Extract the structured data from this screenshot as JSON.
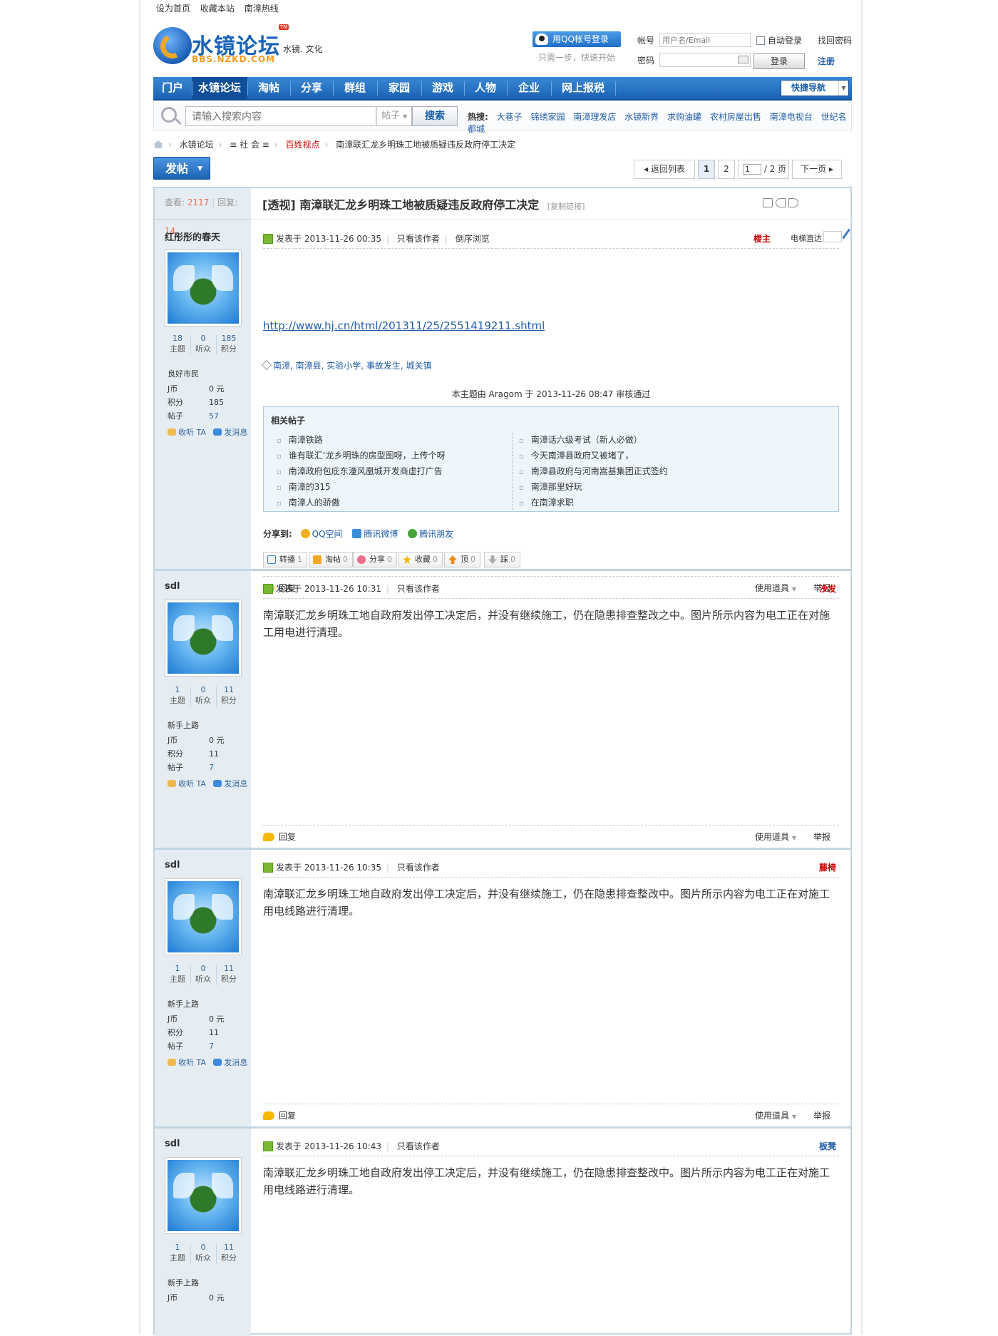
{
  "toplinks": [
    "设为首页",
    "收藏本站",
    "南漳热线"
  ],
  "logo": {
    "title": "水镜论坛",
    "sub": "BBS.NZKD.COM",
    "tm": "TM",
    "slogan": "水镜. 文化"
  },
  "login": {
    "qq_button": "用QQ帐号登录",
    "qq_hint": "只需一步，快速开始",
    "account_label": "帐号",
    "account_placeholder": "用户名/Email",
    "password_label": "密码",
    "auto_login": "自动登录",
    "login_button": "登录",
    "find_password": "找回密码",
    "register": "注册"
  },
  "nav": {
    "items": [
      "门户",
      "水镜论坛",
      "淘帖",
      "分享",
      "群组",
      "家园",
      "游戏",
      "人物",
      "企业",
      "网上报税"
    ],
    "active": "水镜论坛",
    "quick_nav": "快捷导航"
  },
  "search": {
    "placeholder": "请输入搜索内容",
    "type": "帖子",
    "button": "搜索",
    "hot_label": "热搜:",
    "hot": [
      "大巷子",
      "锦绣家园",
      "南漳理发店",
      "水镜新界",
      "求购油罐",
      "农村房屋出售",
      "南漳电视台",
      "世纪名都城"
    ]
  },
  "breadcrumb": [
    "水镜论坛",
    "≡ 社 会 ≡",
    "百姓视点",
    "南漳联汇龙乡明珠工地被质疑违反政府停工决定"
  ],
  "toolbar": {
    "post_button": "发帖",
    "back": "返回列表",
    "pages": [
      "1",
      "2"
    ],
    "page_input": "1",
    "page_total": "/ 2 页",
    "next": "下一页"
  },
  "thread": {
    "views_label": "查看:",
    "views": "2117",
    "replies_label": "回复:",
    "replies": "14",
    "title": "[透视] 南漳联汇龙乡明珠工地被质疑违反政府停工决定",
    "copy_link": "[复制链接]"
  },
  "posts": [
    {
      "author": "红彤彤的春天",
      "topics": "18",
      "topics_label": "主题",
      "fans": "0",
      "fans_label": "听众",
      "credits": "185",
      "credits_label": "积分",
      "rank": "良好市民",
      "coins_label": "J币",
      "coins": "0 元",
      "score_label": "积分",
      "score": "185",
      "posts_label": "帖子",
      "posts_count": "57",
      "follow": "收听 TA",
      "message": "发消息",
      "posted_label": "发表于",
      "time": "2013-11-26 00:35",
      "only_author": "只看该作者",
      "reverse": "倒序浏览",
      "floor": "楼主",
      "elevator": "电梯直达",
      "link": "http://www.hj.cn/html/201311/25/2551419211.shtml",
      "tags": "南漳, 南漳县, 实验小学, 事故发生, 城关镇",
      "review": "本主题由  Aragom 于  2013-11-26 08:47 审核通过"
    },
    {
      "author": "sdl",
      "topics": "1",
      "topics_label": "主题",
      "fans": "0",
      "fans_label": "听众",
      "credits": "11",
      "credits_label": "积分",
      "rank": "新手上路",
      "coins_label": "J币",
      "coins": "0 元",
      "score_label": "积分",
      "score": "11",
      "posts_label": "帖子",
      "posts_count": "7",
      "follow": "收听 TA",
      "message": "发消息",
      "posted_label": "发表于",
      "time": "2013-11-26 10:31",
      "only_author": "只看该作者",
      "floor": "沙发",
      "content": "南漳联汇龙乡明珠工地自政府发出停工决定后，并没有继续施工，仍在隐患排查整改之中。图片所示内容为电工正在对施工用电进行清理。"
    },
    {
      "author": "sdl",
      "topics": "1",
      "topics_label": "主题",
      "fans": "0",
      "fans_label": "听众",
      "credits": "11",
      "credits_label": "积分",
      "rank": "新手上路",
      "coins_label": "J币",
      "coins": "0 元",
      "score_label": "积分",
      "score": "11",
      "posts_label": "帖子",
      "posts_count": "7",
      "follow": "收听 TA",
      "message": "发消息",
      "posted_label": "发表于",
      "time": "2013-11-26 10:35",
      "only_author": "只看该作者",
      "floor": "藤椅",
      "content": "南漳联汇龙乡明珠工地自政府发出停工决定后，并没有继续施工，仍在隐患排查整改中。图片所示内容为电工正在对施工用电线路进行清理。"
    },
    {
      "author": "sdl",
      "topics": "1",
      "topics_label": "主题",
      "fans": "0",
      "fans_label": "听众",
      "credits": "11",
      "credits_label": "积分",
      "rank": "新手上路",
      "coins_label": "J币",
      "coins": "0 元",
      "posted_label": "发表于",
      "time": "2013-11-26 10:43",
      "only_author": "只看该作者",
      "floor": "板凳",
      "content": "南漳联汇龙乡明珠工地自政府发出停工决定后，并没有继续施工，仍在隐患排查整改中。图片所示内容为电工正在对施工用电线路进行清理。"
    }
  ],
  "related": {
    "title": "相关帖子",
    "left": [
      "南漳铁路",
      "谁有联汇‘龙乡明珠的房型图呀，上传个呀",
      "南漳政府包庇东潼风凰城开发商虚打广告",
      "南漳的315",
      "南漳人的骄傲"
    ],
    "right": [
      "南漳话六级考试（新人必做）",
      "今天南漳县政府又被堵了，",
      "南漳县政府与河南嵩基集团正式签约",
      "南漳那里好玩",
      "在南漳求职"
    ]
  },
  "share": {
    "label": "分享到:",
    "qzone": "QQ空间",
    "weibo": "腾讯微博",
    "friends": "腾讯朋友"
  },
  "actions": [
    {
      "label": "转播",
      "count": "1"
    },
    {
      "label": "淘帖",
      "count": "0"
    },
    {
      "label": "分享",
      "count": "0"
    },
    {
      "label": "收藏",
      "count": "0"
    },
    {
      "label": "顶",
      "count": "0"
    },
    {
      "label": "踩",
      "count": "0"
    }
  ],
  "post_footer": {
    "reply": "回复",
    "tools": "使用道具",
    "report": "举报"
  },
  "colors": {
    "nav": "#1a62b4",
    "frame": "#c2d5e3",
    "sidebar": "#e5edf2",
    "link": "#1f5ca8",
    "accent_red": "#cc0000"
  }
}
